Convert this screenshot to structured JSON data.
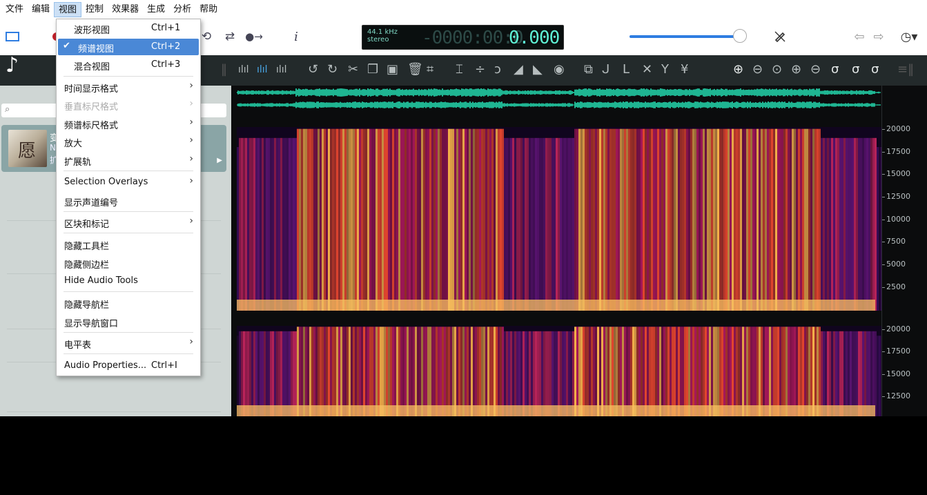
{
  "menubar": {
    "items": [
      "文件",
      "编辑",
      "视图",
      "控制",
      "效果器",
      "生成",
      "分析",
      "帮助"
    ],
    "active_index": 2
  },
  "toolbar": {
    "display": {
      "sample_rate": "44.1 kHz",
      "channels": "stereo",
      "time_dim": "-0000:00:0",
      "time_value": "0.000"
    },
    "icons": [
      "view-toggle-icon",
      "record-icon",
      "loop-icon",
      "repeat-icon",
      "skip-icon",
      "info-icon",
      "volume-slider",
      "pen-icon",
      "back-arrow-icon",
      "forward-arrow-icon",
      "history-icon"
    ],
    "info_label": "i",
    "volume_level": 0.92
  },
  "sidebar": {
    "search_icon": "🔍",
    "track": {
      "cover_glyph": "愿",
      "title_peek": "变",
      "sub_peek": "N",
      "sub2_peek": "扩"
    }
  },
  "spectrogram": {
    "ruler_top": [
      "20000",
      "17500",
      "15000",
      "12500",
      "10000",
      "7500",
      "5000",
      "2500"
    ],
    "ruler_bottom": [
      "20000",
      "17500",
      "15000",
      "12500"
    ]
  },
  "view_menu": {
    "items": [
      {
        "label": "波形视图",
        "shortcut": "Ctrl+1"
      },
      {
        "label": "频谱视图",
        "shortcut": "Ctrl+2",
        "checked": true
      },
      {
        "label": "混合视图",
        "shortcut": "Ctrl+3"
      },
      {
        "label": "时间显示格式",
        "submenu": true
      },
      {
        "label": "垂直标尺格式",
        "submenu": true,
        "disabled": true
      },
      {
        "label": "频谱标尺格式",
        "submenu": true
      },
      {
        "label": "放大",
        "submenu": true
      },
      {
        "label": "扩展轨",
        "submenu": true
      },
      {
        "label": "Selection Overlays",
        "submenu": true
      },
      {
        "label": "显示声道编号"
      },
      {
        "label": "区块和标记",
        "submenu": true
      },
      {
        "label": "隐藏工具栏"
      },
      {
        "label": "隐藏侧边栏"
      },
      {
        "label": "Hide Audio Tools"
      },
      {
        "label": "隐藏导航栏"
      },
      {
        "label": "显示导航窗口"
      },
      {
        "label": "电平表",
        "submenu": true
      },
      {
        "label": "Audio Properties...",
        "shortcut": "Ctrl+I"
      }
    ]
  },
  "colors": {
    "accent": "#4a88d6",
    "wave": "#1fb592",
    "dark_bg": "#232a2b",
    "sidebar": "#cfd6d4"
  }
}
